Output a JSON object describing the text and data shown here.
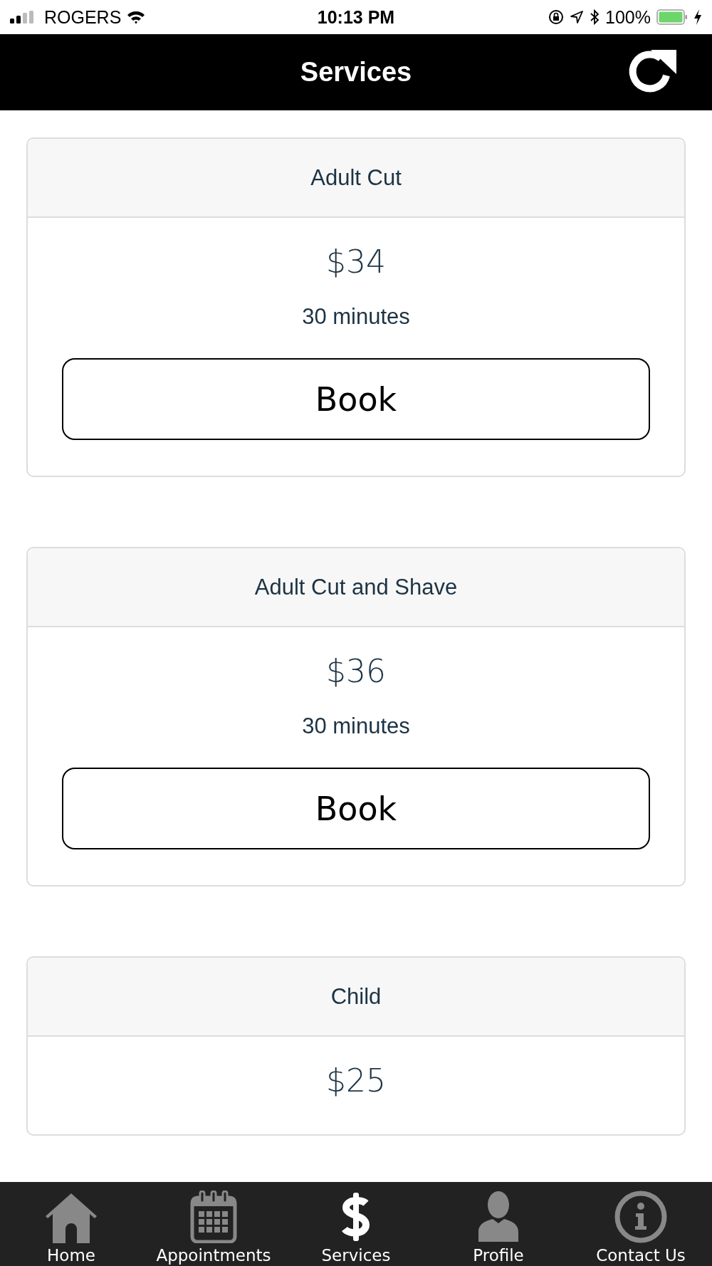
{
  "status_bar": {
    "carrier": "ROGERS",
    "time": "10:13 PM",
    "battery": "100%"
  },
  "header": {
    "title": "Services"
  },
  "services": [
    {
      "name": "Adult Cut",
      "price": "$34",
      "duration": "30 minutes",
      "button": "Book"
    },
    {
      "name": "Adult Cut and Shave",
      "price": "$36",
      "duration": "30 minutes",
      "button": "Book"
    },
    {
      "name": "Child",
      "price": "$25"
    }
  ],
  "tabs": [
    {
      "label": "Home",
      "kind": "home",
      "selected": false
    },
    {
      "label": "Appointments",
      "kind": "calendar",
      "selected": false
    },
    {
      "label": "Services",
      "kind": "dollar",
      "selected": true
    },
    {
      "label": "Profile",
      "kind": "person",
      "selected": false
    },
    {
      "label": "Contact Us",
      "kind": "info",
      "selected": false
    }
  ]
}
